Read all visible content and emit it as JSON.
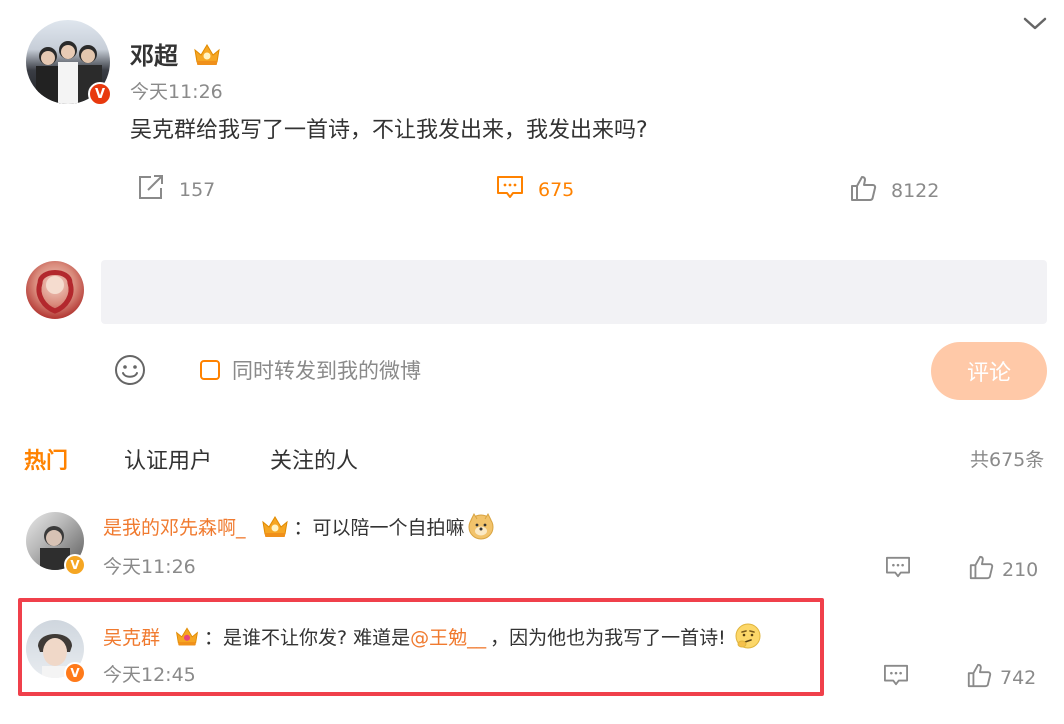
{
  "post": {
    "author": "邓超",
    "time": "今天11:26",
    "text": "吴克群给我写了一首诗，不让我发出来，我发出来吗?",
    "share_count": "157",
    "comment_count": "675",
    "like_count": "8122"
  },
  "composer": {
    "input_value": "",
    "repost_label": "同时转发到我的微博",
    "submit_label": "评论"
  },
  "tabs": {
    "hot": "热门",
    "verified": "认证用户",
    "following": "关注的人",
    "total": "共675条"
  },
  "comments": [
    {
      "user": "是我的邓先森啊_",
      "sep": "：",
      "text": "可以陪一个自拍嘛",
      "time": "今天11:26",
      "likes": "210"
    },
    {
      "user": "吴克群",
      "sep": "：",
      "text_before": "是谁不让你发? 难道是",
      "mention": "@王勉__",
      "text_after": "，因为他也为我写了一首诗!",
      "time": "今天12:45",
      "likes": "742"
    }
  ],
  "colors": {
    "accent": "#ff8200",
    "username": "#f07a2f",
    "highlight_border": "#f0404b",
    "submit_bg": "#ffc9a8",
    "input_bg": "#f2f2f5"
  }
}
